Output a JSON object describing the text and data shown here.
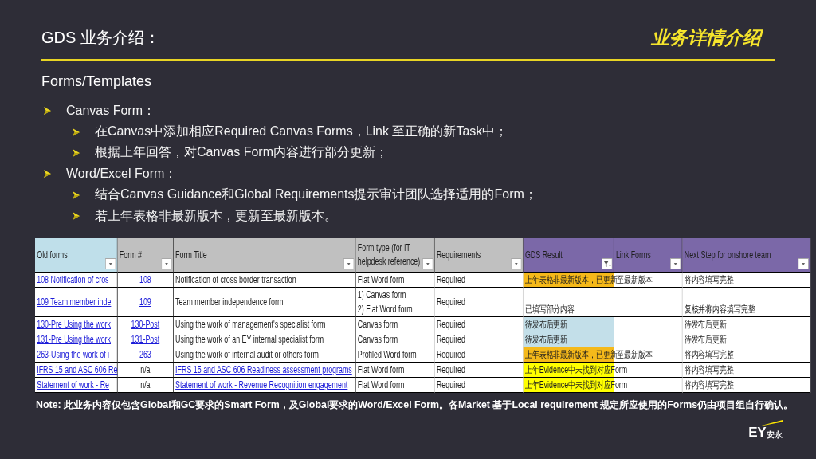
{
  "header": {
    "title": "GDS 业务介绍：",
    "tag": "业务详情介绍",
    "subtitle": "Forms/Templates"
  },
  "bullets": [
    {
      "text": "Canvas Form：",
      "children": [
        {
          "text": "在Canvas中添加相应Required Canvas Forms，Link 至正确的新Task中；"
        },
        {
          "text": "根据上年回答，对Canvas Form内容进行部分更新；"
        }
      ]
    },
    {
      "text": "Word/Excel Form：",
      "children": [
        {
          "text": "结合Canvas Guidance和Global Requirements提示审计团队选择适用的Form；"
        },
        {
          "text": "若上年表格非最新版本，更新至最新版本。"
        }
      ]
    }
  ],
  "table": {
    "columns": [
      {
        "label": "Old forms",
        "color": "#bfdfea",
        "filtered": false
      },
      {
        "label": "Form #",
        "color": "#c0c0c0",
        "filtered": false
      },
      {
        "label": "Form Title",
        "color": "#c0c0c0",
        "filtered": false
      },
      {
        "label": "Form type (for IT helpdesk reference)",
        "color": "#c0c0c0",
        "filtered": false
      },
      {
        "label": "Requirements",
        "color": "#c0c0c0",
        "filtered": false
      },
      {
        "label": "GDS Result",
        "color": "#7b68a8",
        "filtered": true
      },
      {
        "label": "Link Forms",
        "color": "#7b68a8",
        "filtered": false
      },
      {
        "label": "Next Step for onshore team",
        "color": "#7b68a8",
        "filtered": false
      }
    ],
    "rows": [
      {
        "old_form": {
          "text": "108 Notification of cros",
          "link": true
        },
        "form_number": {
          "text": "108",
          "link": true
        },
        "form_title": {
          "text": "Notification of cross border transaction",
          "link": false
        },
        "form_type": "Flat Word form",
        "requirement": "Required",
        "gds_result": {
          "text": "上年表格非最新版本，已更新至最新版本",
          "color": "#f5b91a"
        },
        "next_step": "将内容填写完整"
      },
      {
        "old_form": {
          "text": "109 Team member inde",
          "link": true
        },
        "form_number": {
          "text": "109",
          "link": true
        },
        "form_title": {
          "text": "Team member independence form",
          "link": false
        },
        "form_type": "1) Canvas form\n2) Flat Word form",
        "requirement": "Required",
        "gds_result": {
          "text": "已填写部分内容"
        },
        "next_step": "复核并将内容填写完整"
      },
      {
        "old_form": {
          "text": "130-Pre Using the work",
          "link": true
        },
        "form_number": {
          "text": "130-Post",
          "link": true
        },
        "form_title": {
          "text": "Using the work of management's specialist form",
          "link": false
        },
        "form_type": "Canvas form",
        "requirement": "Required",
        "gds_result": {
          "text": "待发布后更新",
          "color": "#c3dfe9"
        },
        "next_step": "待发布后更新"
      },
      {
        "old_form": {
          "text": "131-Pre Using the work",
          "link": true
        },
        "form_number": {
          "text": "131-Post",
          "link": true
        },
        "form_title": {
          "text": "Using the work of an EY internal specialist form",
          "link": false
        },
        "form_type": "Canvas form",
        "requirement": "Required",
        "gds_result": {
          "text": "待发布后更新",
          "color": "#c3dfe9"
        },
        "next_step": "待发布后更新"
      },
      {
        "old_form": {
          "text": "263-Using the work of i",
          "link": true
        },
        "form_number": {
          "text": "263",
          "link": true
        },
        "form_title": {
          "text": "Using the work of internal audit or others form",
          "link": false
        },
        "form_type": "Profiled Word form",
        "requirement": "Required",
        "gds_result": {
          "text": "上年表格非最新版本，已更新至最新版本",
          "color": "#f5b91a"
        },
        "next_step": "将内容填写完整"
      },
      {
        "old_form": {
          "text": "IFRS 15 and ASC 606 Re",
          "link": true
        },
        "form_number": {
          "text": "n/a",
          "link": false
        },
        "form_title": {
          "text": "IFRS 15 and ASC 606 Readiness assessment programs",
          "link": true
        },
        "form_type": "Flat Word form",
        "requirement": "Required",
        "gds_result": {
          "text": "上年Evidence中未找到对应Form",
          "color": "#ffff00"
        },
        "next_step": "将内容填写完整"
      },
      {
        "old_form": {
          "text": "Statement of work - Re",
          "link": true
        },
        "form_number": {
          "text": "n/a",
          "link": false
        },
        "form_title": {
          "text": "Statement of work - Revenue Recognition engagement",
          "link": true
        },
        "form_type": "Flat Word form",
        "requirement": "Required",
        "gds_result": {
          "text": "上年Evidence中未找到对应Form",
          "color": "#ffff00"
        },
        "next_step": "将内容填写完整"
      }
    ]
  },
  "note": "Note: 此业务内容仅包含Global和GC要求的Smart Form，及Global要求的Word/Excel Form。各Market 基于Local requirement 规定所应使用的Forms仍由项目组自行确认。",
  "logo": {
    "text": "EY",
    "subtext": "安永"
  }
}
